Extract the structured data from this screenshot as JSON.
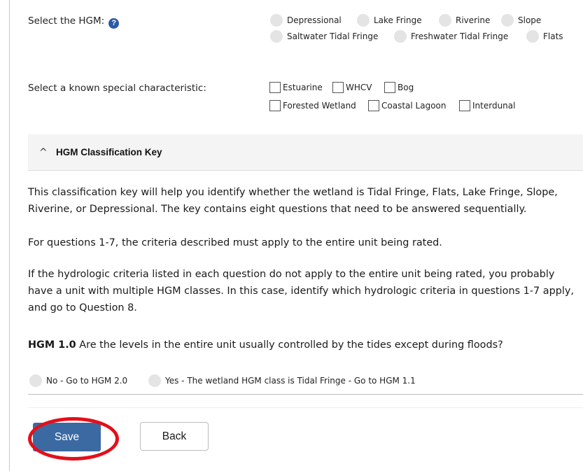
{
  "hgm": {
    "label": "Select the HGM:",
    "help_icon": "?",
    "options": [
      "Depressional",
      "Lake Fringe",
      "Riverine",
      "Slope",
      "Saltwater Tidal Fringe",
      "Freshwater Tidal Fringe",
      "Flats"
    ]
  },
  "special": {
    "label": "Select a known special characteristic:",
    "options": [
      "Estuarine",
      "WHCV",
      "Bog",
      "Forested Wetland",
      "Coastal Lagoon",
      "Interdunal"
    ]
  },
  "accordion": {
    "caret": "^",
    "title": "HGM Classification Key",
    "paragraphs": [
      "This classification key will help you identify whether the wetland is Tidal Fringe, Flats, Lake Fringe, Slope, Riverine, or Depressional. The key contains eight questions that need to be answered sequentially.",
      "For questions 1-7, the criteria described must apply to the entire unit being rated.",
      "If the hydrologic criteria listed in each question do not apply to the entire unit being rated, you probably have a unit with multiple HGM classes. In this case, identify which hydrologic criteria in questions 1-7 apply, and go to Question 8."
    ],
    "question": {
      "number": "HGM 1.0",
      "text": " Are the levels in the entire unit usually controlled by the tides except during floods?"
    },
    "answers": [
      "No - Go to HGM 2.0",
      "Yes - The wetland HGM class is Tidal Fringe - Go to HGM 1.1"
    ]
  },
  "buttons": {
    "save": "Save",
    "back": "Back"
  },
  "colors": {
    "primary": "#3b6aa3",
    "annotation": "#e3101a",
    "help_icon": "#2b5aa8"
  }
}
